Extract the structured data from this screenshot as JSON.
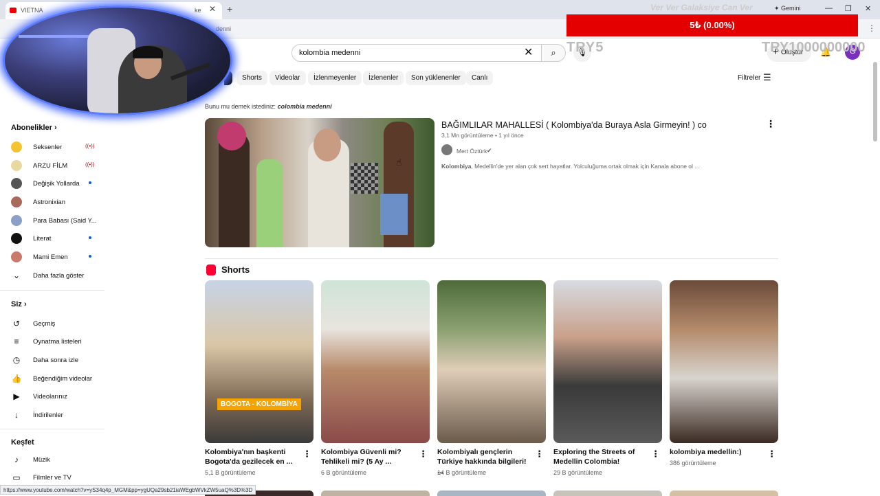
{
  "browser": {
    "tab_title": "VIETNA",
    "tab_frag": "ke",
    "address_fragment": "denni",
    "gemini_label": "Gemini",
    "status_url": "https://www.youtube.com/watch?v=yS34q4p_MGM&pp=ygUQa29sb21iaWEgbWVkZW5uaQ%3D%3D"
  },
  "overlay": {
    "banner_text": "Ver Ver Galaksiye Can Ver",
    "donation": "5₺ (0.00%)",
    "try_small": "TRY5",
    "try_big": "TRY1000000000"
  },
  "header": {
    "search_value": "kolombia medenni",
    "create_label": "Oluştur",
    "avatar_letter": "G"
  },
  "chips": [
    "Shorts",
    "Videolar",
    "İzlenmeyenler",
    "İzlenenler",
    "Son yüklenenler",
    "Canlı"
  ],
  "filters_label": "Filtreler",
  "did_you_mean": {
    "prefix": "Bunu mu demek istediniz:",
    "suggestion": "colombia medenni"
  },
  "sidebar": {
    "subs_heading": "Abonelikler",
    "subs": [
      {
        "label": "Seksenler",
        "badge": "live"
      },
      {
        "label": "ARZU FİLM",
        "badge": "live"
      },
      {
        "label": "Değişik Yollarda",
        "badge": "dot"
      },
      {
        "label": "Astronixian",
        "badge": ""
      },
      {
        "label": "Para Babası (Said Y...",
        "badge": ""
      },
      {
        "label": "Literat",
        "badge": "dot"
      },
      {
        "label": "Mami Emen",
        "badge": "dot"
      }
    ],
    "show_more": "Daha fazla göster",
    "you_heading": "Siz",
    "you_items": [
      "Geçmiş",
      "Oynatma listeleri",
      "Daha sonra izle",
      "Beğendiğim videolar",
      "Videolarınız",
      "İndirilenler"
    ],
    "explore_heading": "Keşfet",
    "explore_items": [
      "Müzik",
      "Filmler ve TV"
    ]
  },
  "video": {
    "title": "BAĞIMLILAR MAHALLESİ ( Kolombiya'da Buraya Asla Girmeyin! ) co",
    "meta": "3,1 Mn görüntüleme • 1 yıl önce",
    "channel": "Mert Öztürk",
    "desc_bold": "Kolombiya",
    "desc_rest": ", Medellin'de yer alan çok sert hayatlar. Yolculuğuma ortak olmak için Kanala abone ol ..."
  },
  "shorts_heading": "Shorts",
  "shorts": [
    {
      "title": "Kolombiya'nın başkenti Bogota'da gezilecek en ...",
      "views": "5,1 B görüntüleme",
      "tag": "BOGOTA - KOLOMBİYA"
    },
    {
      "title": "Kolombiya Güvenli mi? Tehlikeli mi? (5 Ay ...",
      "views": "6 B görüntüleme",
      "tag": ""
    },
    {
      "title": "Kolombiyalı gençlerin Türkiye hakkında bilgileri! ...",
      "views": "14 B görüntüleme",
      "tag": ""
    },
    {
      "title": "Exploring the Streets of Medellin Colombia!",
      "views": "29 B görüntüleme",
      "tag": ""
    },
    {
      "title": "kolombiya medellin:)",
      "views": "386 görüntüleme",
      "tag": ""
    }
  ],
  "icons": {
    "search": "search-icon",
    "clear": "close-icon",
    "mic": "mic-icon",
    "bell": "bell-icon",
    "filters": "sliders-icon",
    "more": "more-vert-icon"
  },
  "colors": {
    "accent_red": "#e40000",
    "yt_red": "#ff0033",
    "live": "#cc0000",
    "avatar": "#7b2fbe"
  }
}
